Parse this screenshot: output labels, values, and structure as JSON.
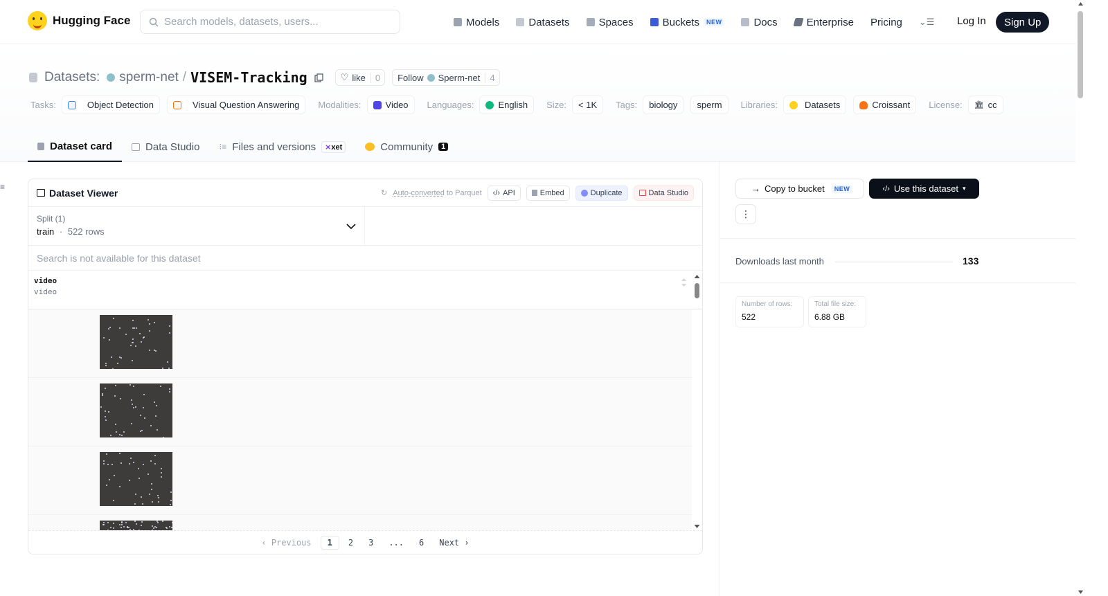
{
  "nav": {
    "logo_text": "Hugging Face",
    "search_placeholder": "Search models, datasets, users...",
    "links": [
      "Models",
      "Datasets",
      "Spaces",
      "Buckets",
      "Docs",
      "Enterprise",
      "Pricing"
    ],
    "buckets_badge": "NEW",
    "login": "Log In",
    "signup": "Sign Up"
  },
  "header": {
    "section_label": "Datasets:",
    "org": "sperm-net",
    "separator": "/",
    "repo": "VISEM-Tracking",
    "like_label": "like",
    "like_count": "0",
    "follow_label": "Follow",
    "follow_org": "Sperm-net",
    "follow_count": "4"
  },
  "tags": {
    "tasks_label": "Tasks:",
    "tasks": [
      "Object Detection",
      "Visual Question Answering"
    ],
    "modalities_label": "Modalities:",
    "modality": "Video",
    "languages_label": "Languages:",
    "language": "English",
    "size_label": "Size:",
    "size": "< 1K",
    "tags_label": "Tags:",
    "tag_list": [
      "biology",
      "sperm"
    ],
    "libraries_label": "Libraries:",
    "libraries": [
      "Datasets",
      "Croissant"
    ],
    "license_label": "License:",
    "license": "cc"
  },
  "tabs": {
    "dataset_card": "Dataset card",
    "data_studio": "Data Studio",
    "files": "Files and versions",
    "xet": "xet",
    "community": "Community",
    "community_count": "1"
  },
  "viewer": {
    "title": "Dataset Viewer",
    "autoconverted": "Auto-converted",
    "to_parquet": "to Parquet",
    "api": "API",
    "embed": "Embed",
    "duplicate": "Duplicate",
    "data_studio": "Data Studio",
    "split_label": "Split (1)",
    "split_name": "train",
    "split_dot": "·",
    "split_rows": "522 rows",
    "search_na": "Search is not available for this dataset",
    "column_name": "video",
    "column_type": "video",
    "pager": {
      "previous": "Previous",
      "pages": [
        "1",
        "2",
        "3",
        "...",
        "6"
      ],
      "next": "Next",
      "current": "1"
    }
  },
  "sidebar": {
    "copy_to_bucket": "Copy to bucket",
    "copy_badge": "NEW",
    "use_dataset": "Use this dataset",
    "downloads_label": "Downloads last month",
    "downloads_value": "133",
    "rows_label": "Number of rows:",
    "rows_value": "522",
    "size_label": "Total file size:",
    "size_value": "6.88 GB"
  },
  "colors": {
    "brand_yellow": "#ffd21e",
    "dark": "#0b0f19",
    "new_badge": "#2563eb"
  }
}
